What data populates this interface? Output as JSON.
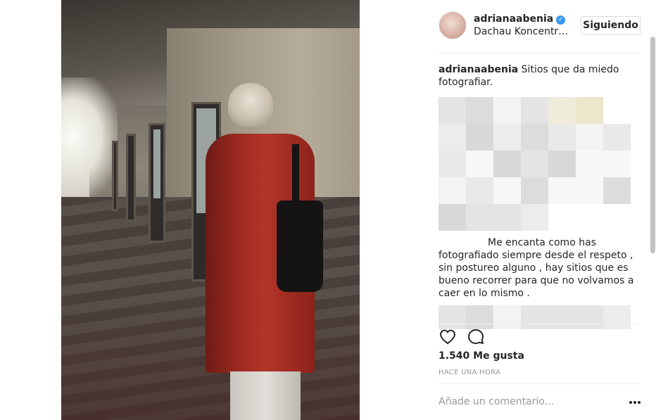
{
  "post": {
    "username": "adrianaabenia",
    "location": "Dachau Koncentr…",
    "follow_label": "Siguiendo",
    "caption_user": "adrianaabenia",
    "caption_text": "Sitios que da miedo fotografiar.",
    "reply_text": "Me encanta como has fotografiado siempre desde el respeto , sin postureo alguno , hay sitios que es bueno recorrer para que no volvamos a caer en lo mismo .",
    "likes": "1.540 Me gusta",
    "time_ago": "HACE UNA HORA",
    "comment_placeholder": "Añade un comentario..."
  },
  "icons": {
    "verified": "verified-badge-icon",
    "like": "heart-icon",
    "comment": "comment-bubble-icon",
    "more": "more-options-icon"
  },
  "colors": {
    "verified": "#3897f0",
    "text": "#262626",
    "muted": "#999999",
    "border": "#dbdbdb"
  }
}
